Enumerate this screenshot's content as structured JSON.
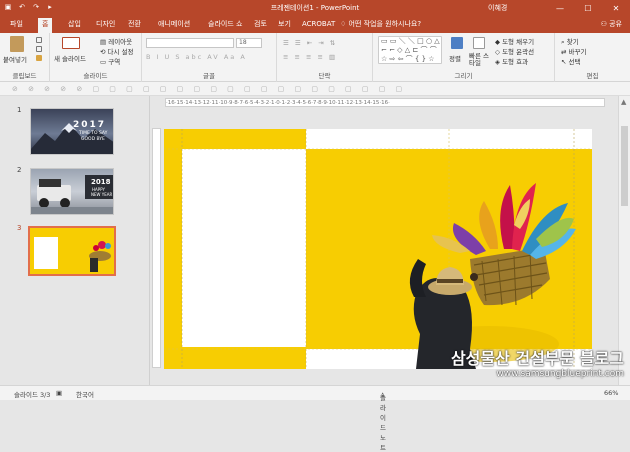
{
  "window": {
    "title": "프레젠테이션1 - PowerPoint",
    "user": "이혜경",
    "min": "—",
    "max": "☐",
    "close": "✕"
  },
  "qat": [
    "▣",
    "↶",
    "↷",
    "▸"
  ],
  "tabs": [
    {
      "label": "파일"
    },
    {
      "label": "홈"
    },
    {
      "label": "삽입"
    },
    {
      "label": "디자인"
    },
    {
      "label": "전환"
    },
    {
      "label": "애니메이션"
    },
    {
      "label": "슬라이드 쇼"
    },
    {
      "label": "검토"
    },
    {
      "label": "보기"
    },
    {
      "label": "ACROBAT"
    }
  ],
  "active_tab": "홈",
  "tell_me": "어떤 작업을 원하시나요?",
  "share": "공유",
  "ribbon": {
    "clipboard": {
      "label": "클립보드",
      "paste": "붙여넣기"
    },
    "slides": {
      "label": "슬라이드",
      "new_slide": "새 슬라이드",
      "layout": "레이아웃",
      "reset": "다시 설정",
      "section": "구역"
    },
    "font": {
      "label": "글꼴",
      "size": "18"
    },
    "paragraph": {
      "label": "단락"
    },
    "drawing": {
      "label": "그리기",
      "arrange": "정렬",
      "quick_styles": "빠른 스타일",
      "fill": "도형 채우기",
      "outline": "도형 윤곽선",
      "effects": "도형 효과"
    },
    "editing": {
      "label": "편집",
      "find": "찾기",
      "replace": "바꾸기",
      "select": "선택"
    }
  },
  "thumbnails": [
    {
      "number": "1",
      "text1": "2017",
      "text2": "TIME TO SAY",
      "text3": "GOOD BYE"
    },
    {
      "number": "2",
      "text1": "2018",
      "text2": "HAPPY",
      "text3": "NEW YEAR"
    },
    {
      "number": "3",
      "text1": "",
      "text2": "",
      "text3": ""
    }
  ],
  "ruler_text": "·16·15·14·13·12·11·10·9·8·7·6·5·4·3·2·1·0·1·2·3·4·5·6·7·8·9·10·11·12·13·14·15·16·",
  "status": {
    "slide": "슬라이드 3/3",
    "language": "한국어",
    "notes": "슬라이드 노트",
    "zoom": "66%"
  },
  "watermark": {
    "line1": "삼성물산 건설부문 블로그",
    "line2": "www.samsungblueprint.com"
  },
  "colors": {
    "accent": "#b7472a",
    "slide_yellow": "#f7cd02",
    "selected_border": "#e26e4a"
  }
}
